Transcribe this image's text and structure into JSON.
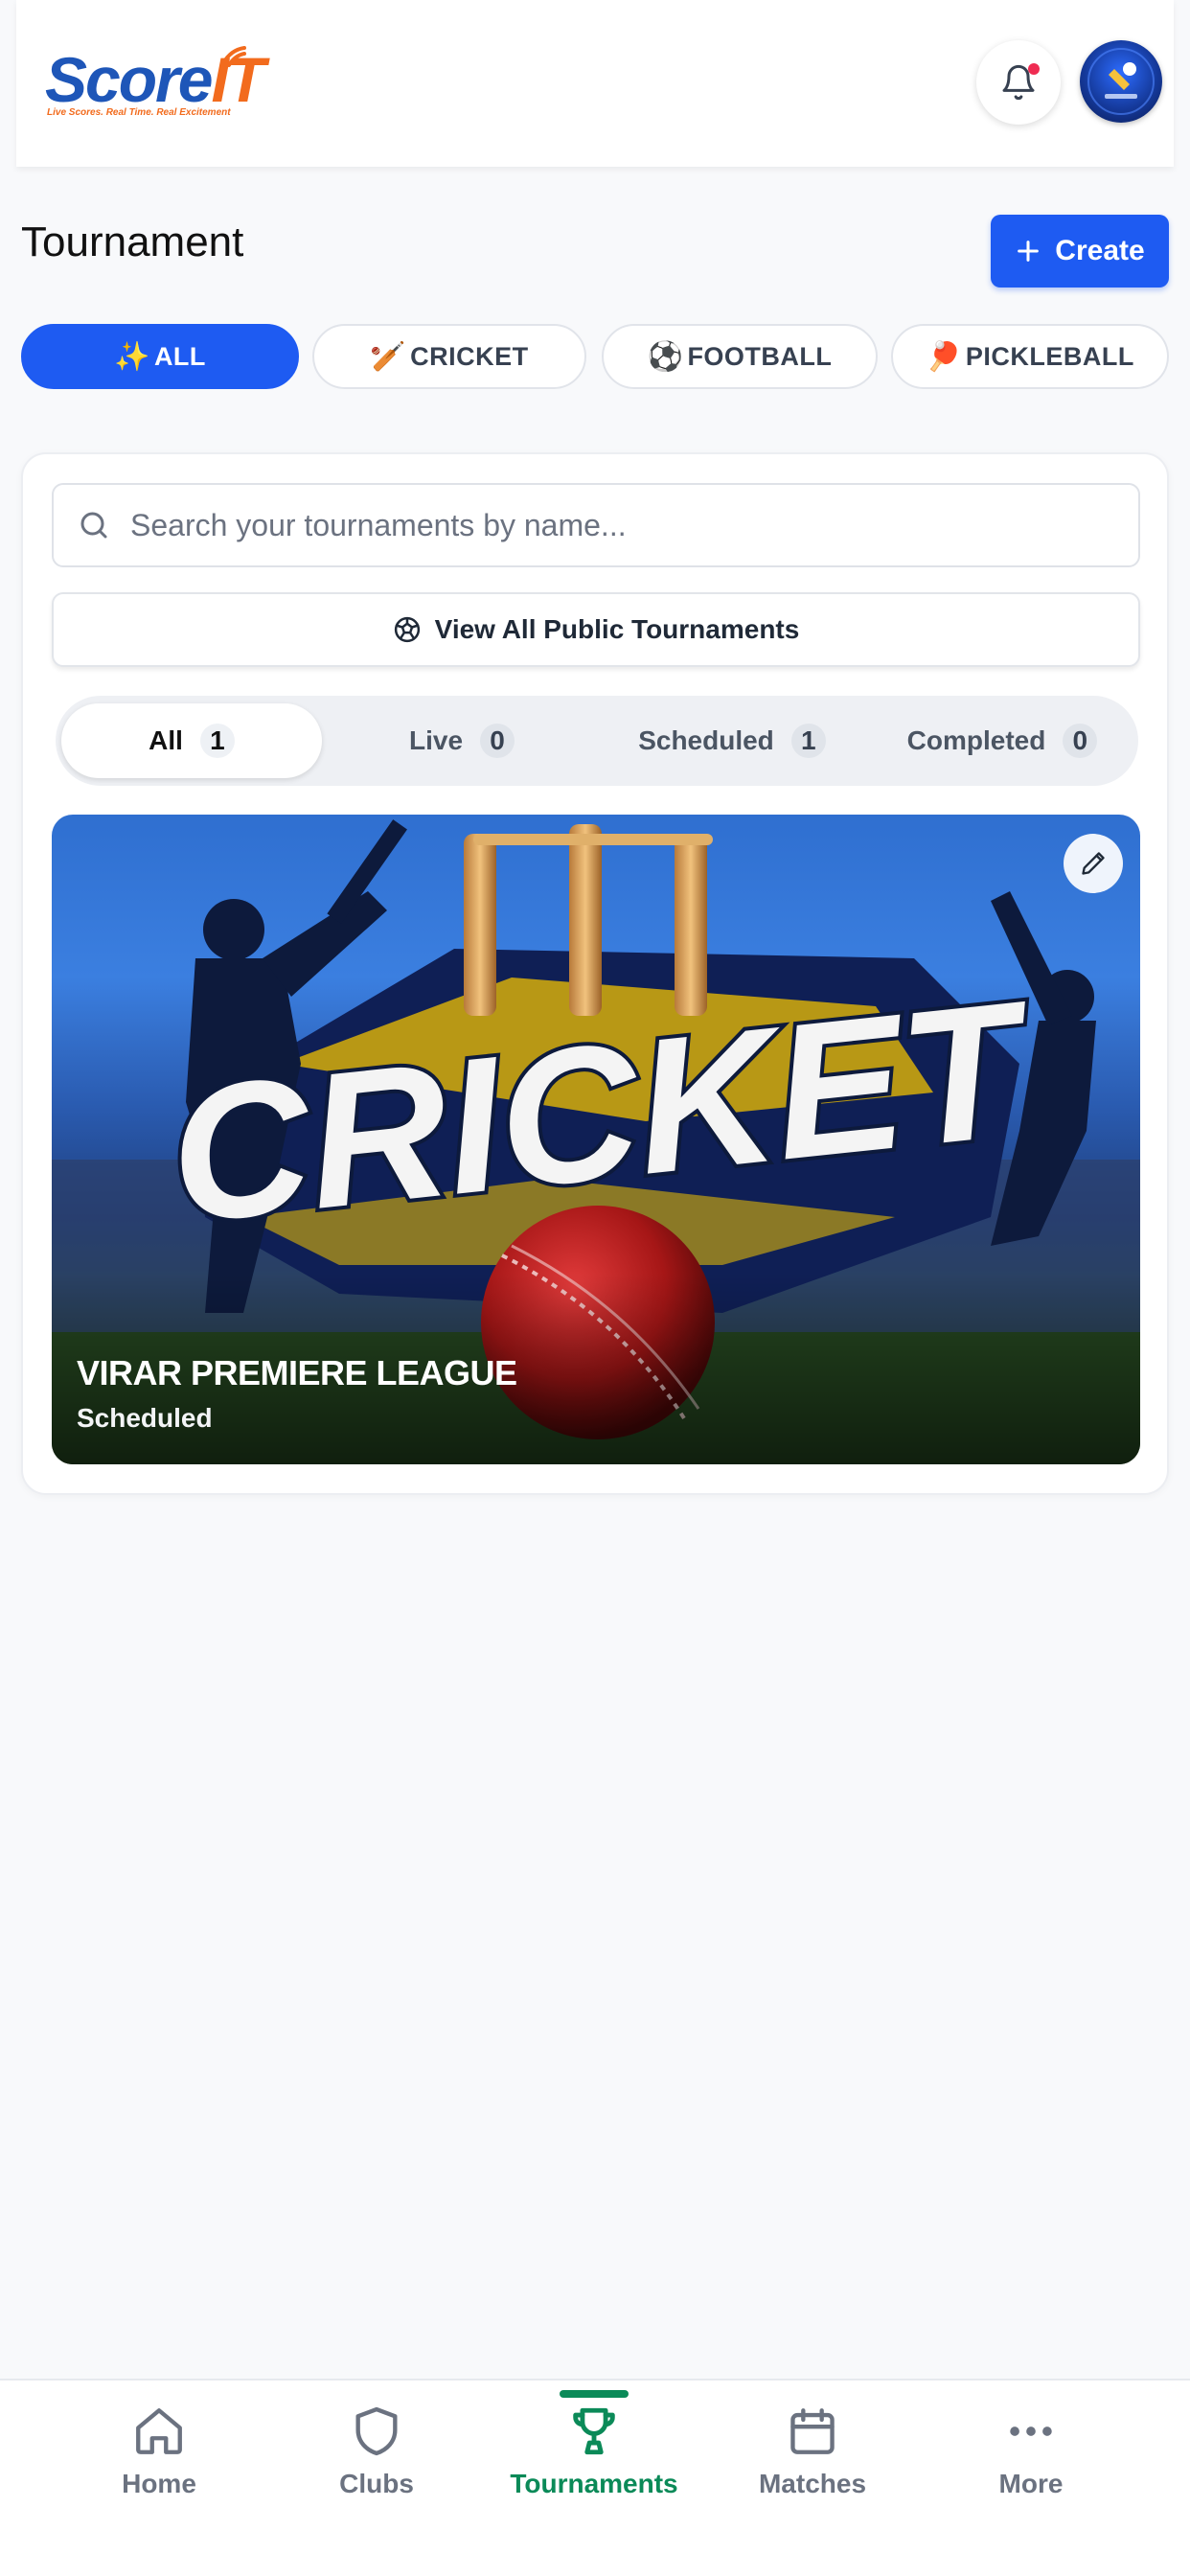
{
  "header": {
    "logo_word_1": "Score",
    "logo_word_2": "IT",
    "logo_tagline": "Live Scores. Real Time. Real Excitement",
    "notification_has_unread": true
  },
  "page": {
    "title": "Tournament",
    "create_label": "Create"
  },
  "sport_filters": [
    {
      "emoji": "✨",
      "label": "ALL",
      "active": true
    },
    {
      "emoji": "🏏",
      "label": "CRICKET",
      "active": false
    },
    {
      "emoji": "⚽",
      "label": "FOOTBALL",
      "active": false
    },
    {
      "emoji": "🏓",
      "label": "PICKLEBALL",
      "active": false
    }
  ],
  "search": {
    "placeholder": "Search your tournaments by name...",
    "value": ""
  },
  "view_all_label": "View All Public Tournaments",
  "status_tabs": [
    {
      "label": "All",
      "count": "1",
      "active": true
    },
    {
      "label": "Live",
      "count": "0",
      "active": false
    },
    {
      "label": "Scheduled",
      "count": "1",
      "active": false
    },
    {
      "label": "Completed",
      "count": "0",
      "active": false
    }
  ],
  "tournaments": [
    {
      "name": "VIRAR PREMIERE LEAGUE",
      "status": "Scheduled",
      "banner_text": "CRICKET"
    }
  ],
  "bottom_nav": [
    {
      "label": "Home",
      "icon": "home-icon",
      "active": false
    },
    {
      "label": "Clubs",
      "icon": "shield-icon",
      "active": false
    },
    {
      "label": "Tournaments",
      "icon": "trophy-icon",
      "active": true
    },
    {
      "label": "Matches",
      "icon": "calendar-icon",
      "active": false
    },
    {
      "label": "More",
      "icon": "more-dots-icon",
      "active": false
    }
  ],
  "colors": {
    "primary": "#1e5bf2",
    "nav_active": "#0b8a58",
    "notification_dot": "#ef2c52"
  }
}
